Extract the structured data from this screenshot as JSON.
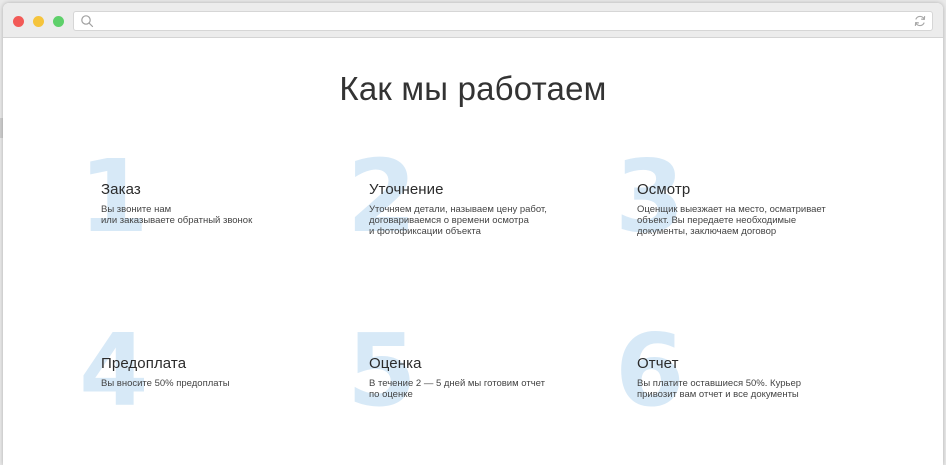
{
  "page": {
    "title": "Как мы работаем"
  },
  "colors": {
    "number_watermark": "#d7e9f7",
    "text": "#2b2b2b",
    "traffic_red": "#f25a57",
    "traffic_yellow": "#f5c43c",
    "traffic_green": "#5ed06a"
  },
  "browser": {
    "icons": [
      "search-icon",
      "reload-icon"
    ]
  },
  "steps": [
    {
      "number": "1",
      "title": "Заказ",
      "description": "Вы звоните нам\nили заказываете обратный звонок"
    },
    {
      "number": "2",
      "title": "Уточнение",
      "description": "Уточняем детали, называем цену работ,\nдоговариваемся о времени осмотра\nи фотофиксации объекта"
    },
    {
      "number": "3",
      "title": "Осмотр",
      "description": "Оценщик выезжает на место, осматривает\nобъект. Вы передаете необходимые\nдокументы, заключаем договор"
    },
    {
      "number": "4",
      "title": "Предоплата",
      "description": "Вы вносите 50% предоплаты"
    },
    {
      "number": "5",
      "title": "Оценка",
      "description": "В течение 2 — 5 дней мы готовим отчет\nпо оценке"
    },
    {
      "number": "6",
      "title": "Отчет",
      "description": "Вы платите оставшиеся 50%. Курьер\nпривозит вам отчет и все документы"
    }
  ]
}
